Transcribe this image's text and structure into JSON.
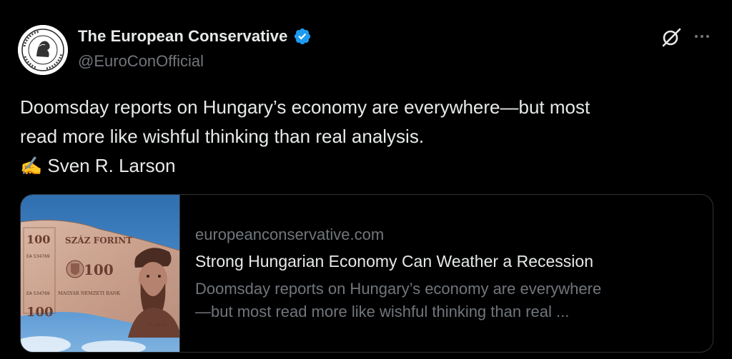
{
  "author": {
    "display_name": "The European Conservative",
    "handle": "@EuroConOfficial",
    "verified": true,
    "verified_color": "#1d9bf0"
  },
  "icons": {
    "avatar": "european-conservative-logo",
    "verified": "verified-badge-icon",
    "grok": "grok-icon",
    "more": "more-dots-icon",
    "writing": "writing-hand-emoji"
  },
  "tweet": {
    "text_line1": "Doomsday reports on Hungary’s economy are everywhere—but most",
    "text_line2": "read more like wishful thinking than real analysis.",
    "author_emoji": "✍️",
    "author_name": "Sven R. Larson"
  },
  "card": {
    "domain": "europeanconservative.com",
    "title": "Strong Hungarian Economy Can Weather a Recession",
    "description_line1": "Doomsday reports on Hungary’s economy are everywhere",
    "description_line2": "—but most read more like wishful thinking than real ...",
    "image_alt": "Hungarian 100 forint banknote",
    "banknote": {
      "value": "100",
      "name": "SZÁZ FORINT",
      "bank": "MAGYAR NEMZETI BANK",
      "serial": "EA 534769"
    }
  },
  "colors": {
    "background": "#000000",
    "text_primary": "#e7e9ea",
    "text_secondary": "#71767b",
    "border": "#2f3336"
  }
}
